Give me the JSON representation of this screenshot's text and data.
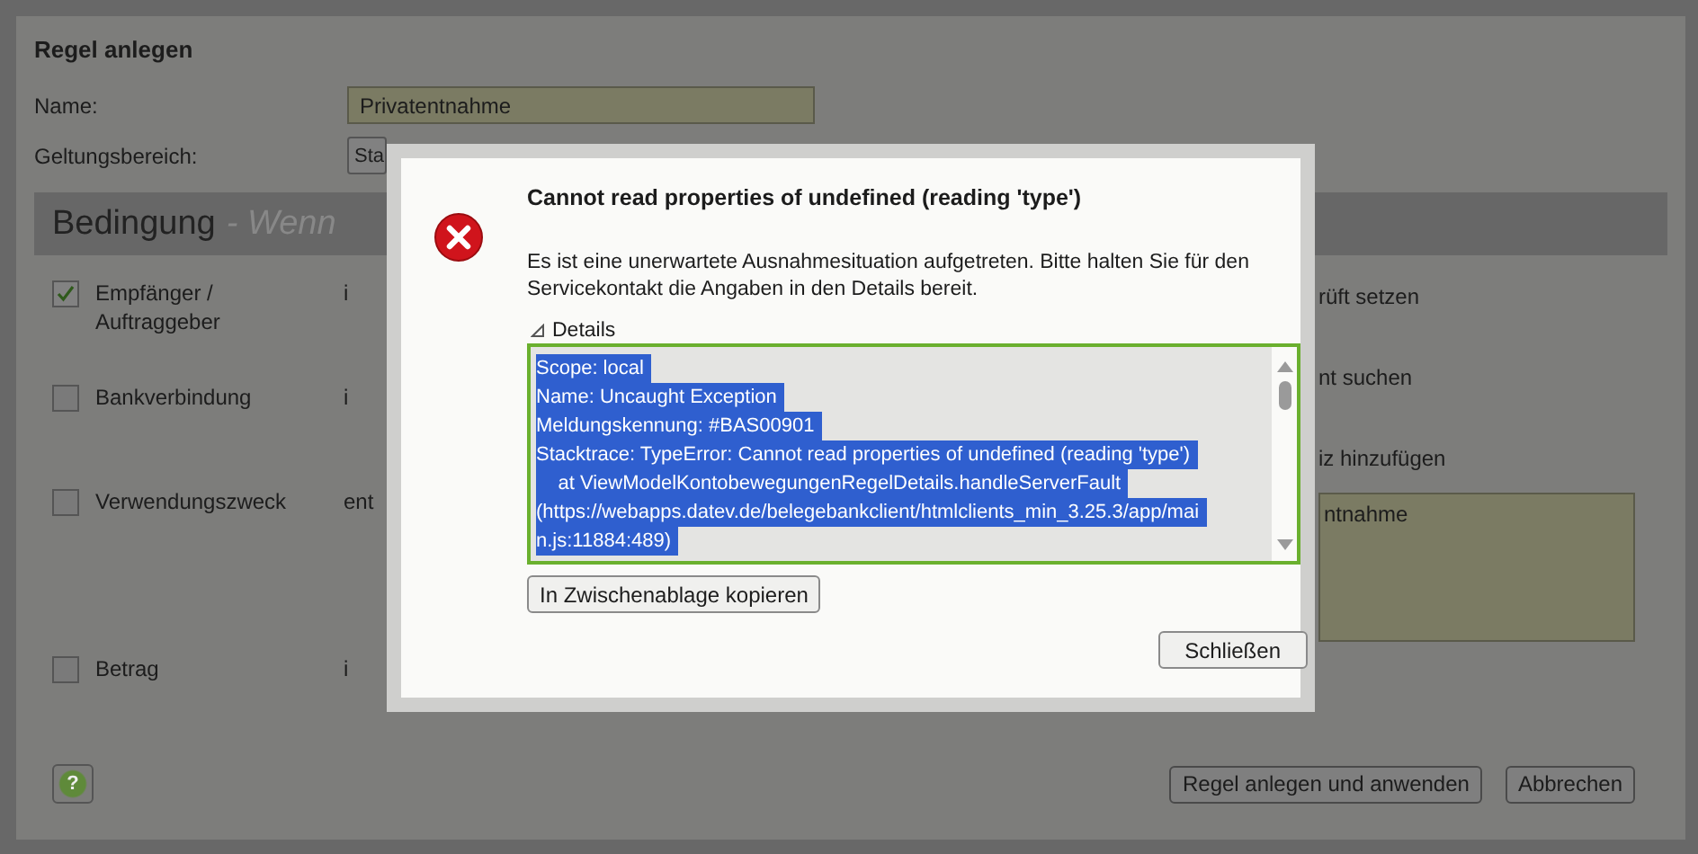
{
  "window": {
    "title": "Regel anlegen"
  },
  "form": {
    "name_label": "Name:",
    "name_value": "Privatentnahme",
    "scope_label": "Geltungsbereich:",
    "scope_button": "Sta"
  },
  "section": {
    "title": "Bedingung",
    "subtitle": "- Wenn"
  },
  "conditions": [
    {
      "label": "Empfänger / Auftraggeber",
      "checked": true,
      "column_2": "i"
    },
    {
      "label": "Bankverbindung",
      "checked": false,
      "column_2": "i"
    },
    {
      "label": "Verwendungszweck",
      "checked": false,
      "column_2": "ent"
    },
    {
      "label": "Betrag",
      "checked": false,
      "column_2": "i"
    }
  ],
  "right_options": [
    "rüft setzen",
    "nt suchen",
    "iz hinzufügen"
  ],
  "note_field": {
    "value": "ntnahme"
  },
  "footer": {
    "help_button": "?",
    "buttons": [
      "Regel anlegen und anwenden",
      "Abbrechen"
    ]
  },
  "dialog": {
    "title": "Cannot read properties of undefined (reading 'type')",
    "message": "Es ist eine unerwartete Ausnahmesituation aufgetreten. Bitte halten Sie für den Servicekontakt die Angaben in den Details bereit.",
    "details_label": "Details",
    "details_expanded": true,
    "details_lines": [
      "Scope: local",
      "Name: Uncaught Exception",
      "Meldungskennung: #BAS00901",
      "Stacktrace: TypeError: Cannot read properties of undefined (reading 'type')",
      "    at ViewModelKontobewegungenRegelDetails.handleServerFault",
      "(https://webapps.datev.de/belegebankclient/htmlclients_min_3.25.3/app/mai",
      "n.js:11884:489)"
    ],
    "copy_button": "In Zwischenablage kopieren",
    "close_button": "Schließen"
  }
}
